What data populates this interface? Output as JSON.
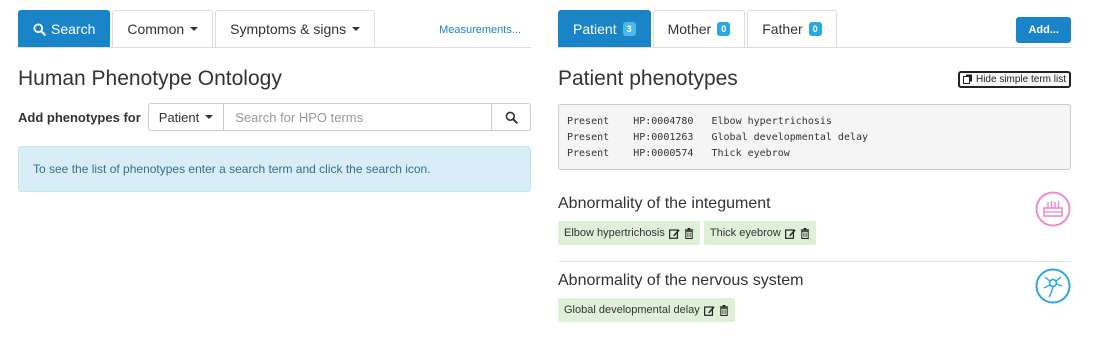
{
  "left": {
    "tabs": [
      {
        "label": "Search",
        "active": true,
        "icon": "search-icon"
      },
      {
        "label": "Common",
        "dropdown": true
      },
      {
        "label": "Symptoms & signs",
        "dropdown": true
      }
    ],
    "measurements_link": "Measurements...",
    "title": "Human Phenotype Ontology",
    "add_label": "Add phenotypes for",
    "subject_select": "Patient",
    "search_placeholder": "Search for HPO terms",
    "info": "To see the list of phenotypes enter a search term and click the search icon."
  },
  "right": {
    "tabs": [
      {
        "label": "Patient",
        "count": "3",
        "active": true
      },
      {
        "label": "Mother",
        "count": "0"
      },
      {
        "label": "Father",
        "count": "0"
      }
    ],
    "add_button": "Add...",
    "title": "Patient phenotypes",
    "hide_button": "Hide simple term list",
    "terms": [
      "Present    HP:0004780   Elbow hypertrichosis",
      "Present    HP:0001263   Global developmental delay",
      "Present    HP:0000574   Thick eyebrow"
    ],
    "sections": [
      {
        "title": "Abnormality of the integument",
        "icon": "skin-icon",
        "color": "#f08bc8",
        "tags": [
          "Elbow hypertrichosis",
          "Thick eyebrow"
        ]
      },
      {
        "title": "Abnormality of the nervous system",
        "icon": "neuron-icon",
        "color": "#2aa8e0",
        "tags": [
          "Global developmental delay"
        ]
      }
    ]
  },
  "colors": {
    "primary": "#1a84c8",
    "info_bg": "#d9edf7",
    "tag_bg": "#dff0d8"
  }
}
